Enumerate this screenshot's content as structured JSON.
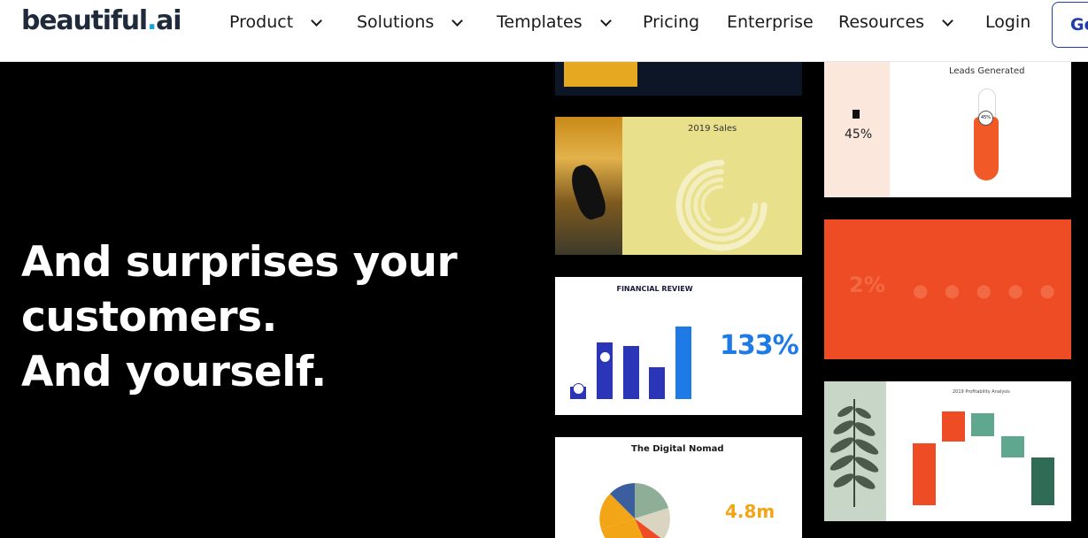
{
  "brand": {
    "logo_main": "beautiful",
    "logo_dot": ".",
    "logo_tld": "ai"
  },
  "nav": {
    "items": [
      {
        "label": "Product",
        "dropdown": true
      },
      {
        "label": "Solutions",
        "dropdown": true
      },
      {
        "label": "Templates",
        "dropdown": true
      },
      {
        "label": "Pricing",
        "dropdown": false
      },
      {
        "label": "Enterprise",
        "dropdown": false
      },
      {
        "label": "Resources",
        "dropdown": true
      },
      {
        "label": "Login",
        "dropdown": false
      }
    ],
    "cta_label": "Ge"
  },
  "hero": {
    "lines": [
      "And surprises your",
      "customers.",
      "And yourself."
    ]
  },
  "slides": {
    "sales": {
      "title": "2019 Sales"
    },
    "leads": {
      "title": "Leads Generated",
      "stat": "45%",
      "marker_value": "45%"
    },
    "orange": {
      "stat": "2%"
    },
    "financial": {
      "title": "FINANCIAL REVIEW",
      "stat": "133%"
    },
    "nomad": {
      "title": "The Digital Nomad",
      "stat": "4.8m"
    },
    "profitability": {
      "title": "2019 Profitability Analysis"
    }
  },
  "colors": {
    "accent_blue": "#1f3da8",
    "logo_dot": "#10a6d9",
    "slide_orange": "#ee4c25",
    "chart_blue": "#1e7be6",
    "chart_navy": "#1f2fb0"
  }
}
